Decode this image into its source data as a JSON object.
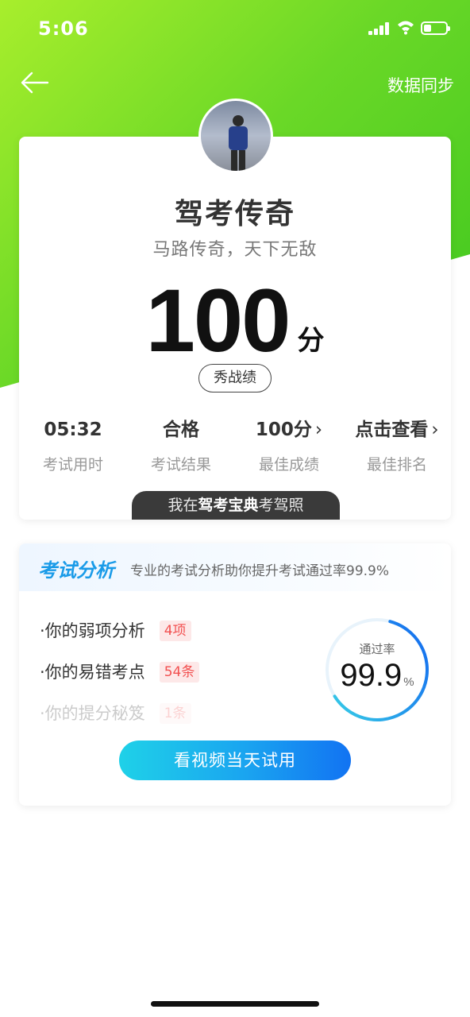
{
  "status_bar": {
    "time": "5:06",
    "battery_level": 0.35
  },
  "nav": {
    "back_icon": "arrow-left-icon",
    "sync_label": "数据同步"
  },
  "profile": {
    "name": "驾考传奇",
    "motto": "马路传奇，天下无敌"
  },
  "score": {
    "value": "100",
    "unit": "分",
    "share_label": "秀战绩"
  },
  "stats": [
    {
      "value": "05:32",
      "label": "考试用时"
    },
    {
      "value": "合格",
      "label": "考试结果"
    },
    {
      "value": "100分",
      "label": "最佳成绩",
      "chevron": "›"
    },
    {
      "value": "点击查看",
      "label": "最佳排名",
      "chevron": "›"
    }
  ],
  "promo": {
    "prefix": "我在",
    "brand": "驾考宝典",
    "suffix": "考驾照"
  },
  "analysis": {
    "title": "考试分析",
    "description": "专业的考试分析助你提升考试通过率99.9%",
    "items": [
      {
        "label": "·你的弱项分析",
        "badge": "4项"
      },
      {
        "label": "·你的易错考点",
        "badge": "54条"
      },
      {
        "label": "·你的提分秘笈",
        "badge": "1条"
      }
    ],
    "pass_rate": {
      "label": "通过率",
      "value": "99.9",
      "unit": "%"
    },
    "cta_label": "看视频当天试用"
  },
  "colors": {
    "accent_green": "#6ad827",
    "accent_blue": "#1a9be8",
    "badge_red": "#f25050"
  }
}
